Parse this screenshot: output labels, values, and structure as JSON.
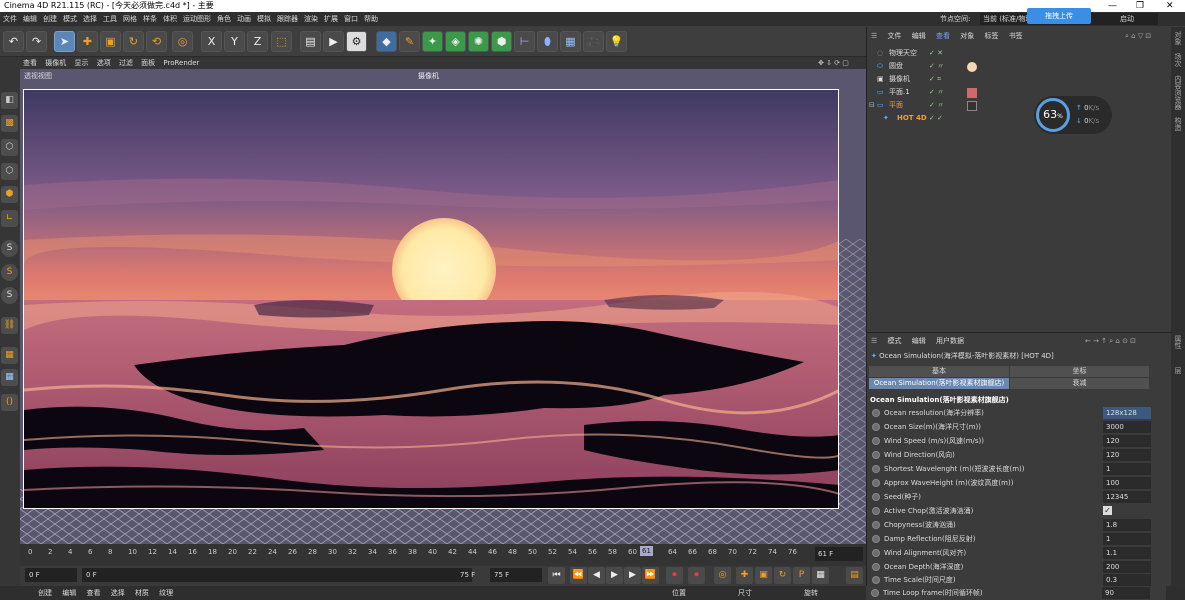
{
  "app": {
    "title": "Cinema 4D R21.115 (RC) - [今天必须做完.c4d *] - 主要"
  },
  "menubar": [
    "文件",
    "编辑",
    "创建",
    "模式",
    "选择",
    "工具",
    "网格",
    "样条",
    "体积",
    "运动图形",
    "角色",
    "动画",
    "模拟",
    "跟踪器",
    "渲染",
    "扩展",
    "窗口",
    "帮助"
  ],
  "layout": {
    "label": "节点空间:",
    "value": "当前 (标准/物理)",
    "tail": "启动"
  },
  "upload_btn": "拖拽上传",
  "viewport": {
    "menu": [
      "查看",
      "摄像机",
      "显示",
      "选项",
      "过滤",
      "面板",
      "ProRender"
    ],
    "title": "透视视图",
    "camera": "摄像机"
  },
  "timeline": {
    "ticks": [
      "0",
      "2",
      "4",
      "6",
      "8",
      "10",
      "12",
      "14",
      "16",
      "18",
      "20",
      "22",
      "24",
      "26",
      "28",
      "30",
      "32",
      "34",
      "36",
      "38",
      "40",
      "42",
      "44",
      "46",
      "48",
      "50",
      "52",
      "54",
      "56",
      "58",
      "60",
      "61",
      "64",
      "66",
      "68",
      "70",
      "72",
      "74",
      "76"
    ],
    "current": "61 F"
  },
  "transport": {
    "start": "0 F",
    "current": "0 F",
    "end_a": "75 F",
    "end_b": "75 F"
  },
  "bottombar": {
    "left": [
      "创建",
      "编辑",
      "查看",
      "选择",
      "材质",
      "纹理"
    ],
    "coords": [
      "位置",
      "尺寸",
      "旋转"
    ]
  },
  "objects": {
    "menu": [
      "文件",
      "编辑",
      "查看",
      "对象",
      "标签",
      "书签"
    ],
    "rows": [
      {
        "name": "物理天空",
        "tags": "✓ ✕"
      },
      {
        "name": "圆盘",
        "tags": "✓ 〃"
      },
      {
        "name": "摄像机",
        "tags": "✓ ⌗"
      },
      {
        "name": "平面.1",
        "tags": "✓ 〃"
      },
      {
        "name": "平面",
        "tags": "✓ 〃"
      },
      {
        "name": "HOT 4D",
        "tags": "✓ ✓"
      }
    ]
  },
  "gauge": {
    "percent": "63",
    "unit": "%",
    "up": "0",
    "down": "0",
    "rate_unit": "K/s"
  },
  "attributes": {
    "menu": [
      "模式",
      "编辑",
      "用户数据"
    ],
    "title": "Ocean Simulation(海洋模拟-落叶影视素材) [HOT 4D]",
    "tabs": [
      "基本",
      "坐标",
      "Ocean Simulation(落叶影视素材旗舰店)",
      "衰减"
    ],
    "section": "Ocean Simulation(落叶影视素材旗舰店)",
    "params": [
      {
        "label": "Ocean resolution(海洋分辨率)",
        "value": "128x128"
      },
      {
        "label": "Ocean Size(m)(海洋尺寸(m))",
        "value": "3000"
      },
      {
        "label": "Wind Speed (m/s)(风速(m/s))",
        "value": "120"
      },
      {
        "label": "Wind Direction(风向)",
        "value": "120"
      },
      {
        "label": "Shortest Wavelenght (m)(短波波长度(m))",
        "value": "1"
      },
      {
        "label": "Approx WaveHeight (m)(波纹高度(m))",
        "value": "100"
      },
      {
        "label": "Seed(种子)",
        "value": "12345"
      },
      {
        "label": "Active Chop(激活波涛汹涌)",
        "value": "✓"
      },
      {
        "label": "Chopyness(波涛汹涌)",
        "value": "1.8"
      },
      {
        "label": "Damp Reflection(阻尼反射)",
        "value": "1"
      },
      {
        "label": "Wind Alignment(风对齐)",
        "value": "1.1"
      },
      {
        "label": "Ocean Depth(海洋深度)",
        "value": "200"
      },
      {
        "label": "Time Scale(时间尺度)",
        "value": "0.3"
      },
      {
        "label": "Time Loop frame(时间循环帧)",
        "value": "90"
      }
    ]
  },
  "rightstrip": [
    "对象",
    "场次",
    "内容浏览器",
    "构造",
    "属性",
    "层"
  ]
}
